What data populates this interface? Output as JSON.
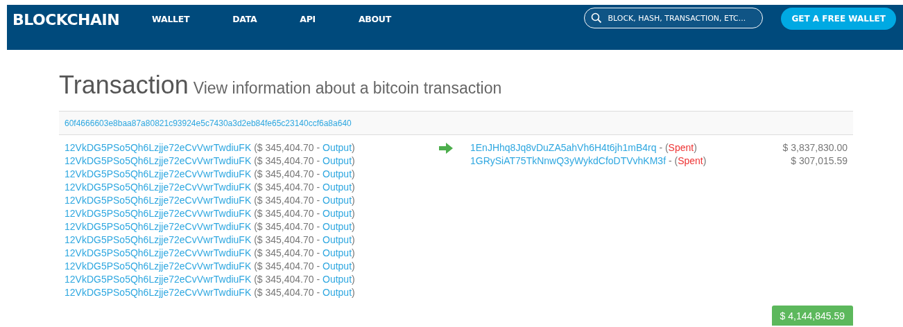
{
  "header": {
    "logo": "BLOCKCHAIN",
    "nav": [
      "WALLET",
      "DATA",
      "API",
      "ABOUT"
    ],
    "search": {
      "placeholder": "BLOCK, HASH, TRANSACTION, ETC..."
    },
    "cta": "GET A FREE WALLET"
  },
  "page": {
    "title": "Transaction",
    "subtitle": "View information about a bitcoin transaction"
  },
  "transaction": {
    "hash": "60f4666603e8baa87a80821c93924e5c7430a3d2eb84fe65c23140ccf6a8a640",
    "inputs": [
      {
        "address": "12VkDG5PSo5Qh6Lzjje72eCvVwrTwdiuFK",
        "before": "($ 345,404.70 - ",
        "link": "Output",
        "after": ")"
      },
      {
        "address": "12VkDG5PSo5Qh6Lzjje72eCvVwrTwdiuFK",
        "before": "($ 345,404.70 - ",
        "link": "Output",
        "after": ")"
      },
      {
        "address": "12VkDG5PSo5Qh6Lzjje72eCvVwrTwdiuFK",
        "before": "($ 345,404.70 - ",
        "link": "Output",
        "after": ")"
      },
      {
        "address": "12VkDG5PSo5Qh6Lzjje72eCvVwrTwdiuFK",
        "before": "($ 345,404.70 - ",
        "link": "Output",
        "after": ")"
      },
      {
        "address": "12VkDG5PSo5Qh6Lzjje72eCvVwrTwdiuFK",
        "before": "($ 345,404.70 - ",
        "link": "Output",
        "after": ")"
      },
      {
        "address": "12VkDG5PSo5Qh6Lzjje72eCvVwrTwdiuFK",
        "before": "($ 345,404.70 - ",
        "link": "Output",
        "after": ")"
      },
      {
        "address": "12VkDG5PSo5Qh6Lzjje72eCvVwrTwdiuFK",
        "before": "($ 345,404.70 - ",
        "link": "Output",
        "after": ")"
      },
      {
        "address": "12VkDG5PSo5Qh6Lzjje72eCvVwrTwdiuFK",
        "before": "($ 345,404.70 - ",
        "link": "Output",
        "after": ")"
      },
      {
        "address": "12VkDG5PSo5Qh6Lzjje72eCvVwrTwdiuFK",
        "before": "($ 345,404.70 - ",
        "link": "Output",
        "after": ")"
      },
      {
        "address": "12VkDG5PSo5Qh6Lzjje72eCvVwrTwdiuFK",
        "before": "($ 345,404.70 - ",
        "link": "Output",
        "after": ")"
      },
      {
        "address": "12VkDG5PSo5Qh6Lzjje72eCvVwrTwdiuFK",
        "before": "($ 345,404.70 - ",
        "link": "Output",
        "after": ")"
      },
      {
        "address": "12VkDG5PSo5Qh6Lzjje72eCvVwrTwdiuFK",
        "before": "($ 345,404.70 - ",
        "link": "Output",
        "after": ")"
      }
    ],
    "outputs": [
      {
        "address": "1EnJHhq8Jq8vDuZA5ahVh6H4t6jh1mB4rq",
        "before": " - (",
        "status": "Spent",
        "after": ")",
        "amount": "$ 3,837,830.00"
      },
      {
        "address": "1GRySiAT75TkNnwQ3yWykdCfoDTVvhKM3f",
        "before": " - (",
        "status": "Spent",
        "after": ")",
        "amount": "$ 307,015.59"
      }
    ],
    "total": "$ 4,144,845.59"
  }
}
